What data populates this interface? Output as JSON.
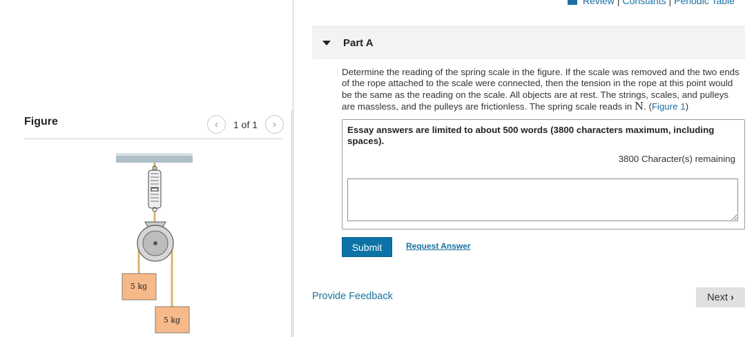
{
  "top_links": [
    "Review",
    "Constants",
    "Periodic Table"
  ],
  "figure": {
    "title": "Figure",
    "pager_text": "1 of 1",
    "prev_icon": "chevron-left-icon",
    "next_icon": "chevron-right-icon",
    "mass_labels": [
      "5 kg",
      "5 kg"
    ]
  },
  "part": {
    "title": "Part A",
    "question_text": "Determine the reading of the spring scale in the figure. If the scale was removed and the two ends of the rope attached to the scale were connected, then the tension in the rope at this point would be the same as the reading on the scale. All objects are at rest. The strings, scales, and pulleys are massless, and the pulleys are frictionless. The spring scale reads in ",
    "unit": "N",
    "figure_link": "Figure 1"
  },
  "answer": {
    "essay_note": "Essay answers are limited to about 500 words (3800 characters maximum, including spaces).",
    "remaining": "3800 Character(s) remaining",
    "value": ""
  },
  "buttons": {
    "submit": "Submit",
    "request_answer": "Request Answer",
    "provide_feedback": "Provide Feedback",
    "next": "Next"
  },
  "colors": {
    "link": "#1a6fa0",
    "submit_bg": "#0b73a5",
    "next_bg": "#e0e0e0",
    "mass_fill": "#f6b98a"
  }
}
